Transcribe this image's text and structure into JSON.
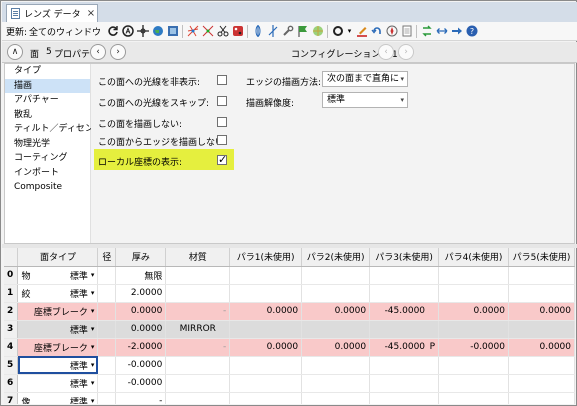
{
  "window": {
    "tab_title": "レンズ データ",
    "close_glyph": "×"
  },
  "toolbar": {
    "update_label": "更新:",
    "update_value": "全てのウィンドウ",
    "icons": [
      "refresh-icon",
      "calc-icon",
      "crosshair-icon",
      "globe-icon",
      "image-icon",
      "scatter-icon",
      "scatter2-icon",
      "scissors-icon",
      "palette-icon",
      "lens-icon",
      "tilt-icon",
      "wrench-icon",
      "flag-icon",
      "grid-icon",
      "ring-icon",
      "highlighter-icon",
      "undo-icon",
      "compass-icon",
      "page-icon",
      "swap-icon",
      "arrows-icon",
      "arrow-right-icon",
      "help-icon"
    ]
  },
  "prop_header": {
    "collapse_glyph": "∧",
    "surface_label": "面",
    "surface_number": "5",
    "properties_label": "プロパティ",
    "config_label": "コンフィグレーション 1/1",
    "prev_glyph": "‹",
    "next_glyph": "›"
  },
  "nav": {
    "items": [
      "タイプ",
      "描画",
      "アパチャー",
      "散乱",
      "ティルト／ディセンタ",
      "物理光学",
      "コーティング",
      "インポート",
      "Composite"
    ],
    "selected": "描画"
  },
  "draw_options": {
    "hide_rays": "この面への光線を非表示:",
    "skip_rays": "この面への光線をスキップ:",
    "no_draw": "この面を描画しない:",
    "no_edges": "この面からエッジを描画しない:",
    "local_axes": "ローカル座標の表示:",
    "local_axes_checked": true,
    "edge_method_label": "エッジの描画方法:",
    "edge_method_value": "次の面まで直角に",
    "resolution_label": "描画解像度:",
    "resolution_value": "標準"
  },
  "table": {
    "headers": [
      "",
      "面タイプ",
      "径",
      "厚み",
      "材質",
      "パラ1(未使用)",
      "パラ2(未使用)",
      "パラ3(未使用)",
      "パラ4(未使用)",
      "パラ5(未使用)"
    ],
    "rows": [
      {
        "idx": "0",
        "name": "物",
        "type": "標準",
        "thick": "無限",
        "mat": "",
        "p1": "",
        "p2": "",
        "p3": "",
        "p3flag": "",
        "p4": "",
        "p5": "",
        "style": ""
      },
      {
        "idx": "1",
        "name": "絞",
        "type": "標準",
        "thick": "2.0000",
        "mat": "",
        "p1": "",
        "p2": "",
        "p3": "",
        "p3flag": "",
        "p4": "",
        "p5": "",
        "style": ""
      },
      {
        "idx": "2",
        "name": "",
        "type": "座標ブレーク",
        "thick": "0.0000",
        "mat": "-",
        "p1": "0.0000",
        "p2": "0.0000",
        "p3": "-45.0000",
        "p3flag": "",
        "p4": "0.0000",
        "p5": "0.0000",
        "style": "pink"
      },
      {
        "idx": "3",
        "name": "",
        "type": "標準",
        "thick": "0.0000",
        "mat": "MIRROR",
        "p1": "",
        "p2": "",
        "p3": "",
        "p3flag": "",
        "p4": "",
        "p5": "",
        "style": "grey"
      },
      {
        "idx": "4",
        "name": "",
        "type": "座標ブレーク",
        "thick": "-2.0000",
        "mat": "-",
        "p1": "0.0000",
        "p2": "0.0000",
        "p3": "-45.0000",
        "p3flag": "P",
        "p4": "-0.0000",
        "p5": "0.0000",
        "style": "pink"
      },
      {
        "idx": "5",
        "name": "",
        "type": "標準",
        "thick": "-0.0000",
        "mat": "",
        "p1": "",
        "p2": "",
        "p3": "",
        "p3flag": "",
        "p4": "",
        "p5": "",
        "style": "sel"
      },
      {
        "idx": "6",
        "name": "",
        "type": "標準",
        "thick": "-0.0000",
        "mat": "",
        "p1": "",
        "p2": "",
        "p3": "",
        "p3flag": "",
        "p4": "",
        "p5": "",
        "style": ""
      },
      {
        "idx": "7",
        "name": "像",
        "type": "標準",
        "thick": "-",
        "mat": "",
        "p1": "",
        "p2": "",
        "p3": "",
        "p3flag": "",
        "p4": "",
        "p5": "",
        "style": ""
      }
    ]
  },
  "colors": {
    "pink_row": "#f9c9c9",
    "grey_row": "#dcdcdc",
    "highlight": "#e5ef3e",
    "selection": "#cde2f7"
  }
}
